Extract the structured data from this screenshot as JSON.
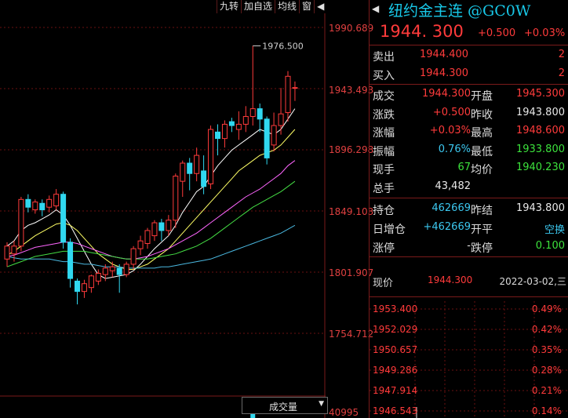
{
  "toolbar": {
    "items": [
      "九转",
      "加自选",
      "均线",
      "窗"
    ],
    "close_label": "◀"
  },
  "price_axis": [
    "1990.689",
    "1943.493",
    "1896.298",
    "1849.103",
    "1801.907",
    "1754.712",
    "40995"
  ],
  "chart_annotation": "1976.500",
  "volume_selector": {
    "label": "成交量",
    "arrow": "▼"
  },
  "title": {
    "text": "纽约金主连 @GC0W",
    "icon": "◀"
  },
  "quote": {
    "price": "1944. 300",
    "change": "+0.500",
    "change_pct": "+0.03%"
  },
  "orderbook": [
    {
      "label": "卖出",
      "price": "1944.400",
      "qty": "2"
    },
    {
      "label": "买入",
      "price": "1944.300",
      "qty": "2"
    }
  ],
  "stats": [
    {
      "l1": "成交",
      "v1": "1944.300",
      "l2": "开盘",
      "v2": "1945.300",
      "c1": "red",
      "c2": "red"
    },
    {
      "l1": "涨跌",
      "v1": "+0.500",
      "l2": "昨收",
      "v2": "1943.800",
      "c1": "red",
      "c2": "wht"
    },
    {
      "l1": "涨幅",
      "v1": "+0.03%",
      "l2": "最高",
      "v2": "1948.600",
      "c1": "red",
      "c2": "red"
    },
    {
      "l1": "振幅",
      "v1": "0.76%",
      "l2": "最低",
      "v2": "1933.800",
      "c1": "cyn",
      "c2": "grn"
    },
    {
      "l1": "现手",
      "v1": "67",
      "l2": "均价",
      "v2": "1940.230",
      "c1": "grn",
      "c2": "grn"
    },
    {
      "l1": "总手",
      "v1": "43,482",
      "l2": "",
      "v2": "",
      "c1": "wht",
      "c2": "wht"
    }
  ],
  "stats2": [
    {
      "l1": "持仓",
      "v1": "462669",
      "l2": "昨结",
      "v2": "1943.800",
      "c1": "cyn",
      "c2": "wht"
    },
    {
      "l1": "日增仓",
      "v1": "+462669",
      "l2": "开平",
      "v2": "空换",
      "c1": "cyn",
      "c2": "cyn"
    },
    {
      "l1": "涨停",
      "v1": "-",
      "l2": "跌停",
      "v2": "0.100",
      "c1": "wht",
      "c2": "grn"
    }
  ],
  "mini": {
    "label": "现价",
    "price": "1944.300",
    "date": "2022-03-02,三",
    "left_axis": [
      "1953.400",
      "1952.029",
      "1950.657",
      "1949.286",
      "1947.914",
      "1946.543"
    ],
    "right_axis": [
      "0.49%",
      "0.42%",
      "0.35%",
      "0.28%",
      "0.21%",
      "0.14%"
    ]
  },
  "chart_data": {
    "type": "candlestick",
    "ylim": [
      1754.712,
      1990.689
    ],
    "y_ticks": [
      1990.689,
      1943.493,
      1896.298,
      1849.103,
      1801.907,
      1754.712
    ],
    "candles": [
      [
        1812,
        1822,
        1806,
        1825,
        "up"
      ],
      [
        1816,
        1822,
        1810,
        1826,
        "up"
      ],
      [
        1822,
        1858,
        1818,
        1860,
        "up"
      ],
      [
        1858,
        1852,
        1848,
        1862,
        "dn"
      ],
      [
        1850,
        1856,
        1847,
        1858,
        "up"
      ],
      [
        1855,
        1850,
        1845,
        1858,
        "dn"
      ],
      [
        1852,
        1858,
        1848,
        1861,
        "up"
      ],
      [
        1853,
        1862,
        1850,
        1866,
        "up"
      ],
      [
        1862,
        1825,
        1820,
        1864,
        "dn"
      ],
      [
        1825,
        1797,
        1790,
        1828,
        "dn"
      ],
      [
        1795,
        1787,
        1777,
        1797,
        "dn"
      ],
      [
        1787,
        1793,
        1782,
        1796,
        "up"
      ],
      [
        1790,
        1799,
        1786,
        1800,
        "up"
      ],
      [
        1795,
        1801,
        1792,
        1804,
        "up"
      ],
      [
        1800,
        1805,
        1795,
        1808,
        "up"
      ],
      [
        1803,
        1806,
        1798,
        1810,
        "up"
      ],
      [
        1805,
        1800,
        1786,
        1808,
        "dn"
      ],
      [
        1800,
        1808,
        1798,
        1810,
        "up"
      ],
      [
        1808,
        1820,
        1804,
        1822,
        "up"
      ],
      [
        1820,
        1826,
        1815,
        1830,
        "up"
      ],
      [
        1824,
        1834,
        1820,
        1836,
        "up"
      ],
      [
        1830,
        1840,
        1826,
        1842,
        "up"
      ],
      [
        1840,
        1834,
        1826,
        1843,
        "dn"
      ],
      [
        1834,
        1842,
        1830,
        1846,
        "up"
      ],
      [
        1842,
        1876,
        1836,
        1878,
        "up"
      ],
      [
        1872,
        1886,
        1860,
        1888,
        "up"
      ],
      [
        1886,
        1878,
        1865,
        1890,
        "dn"
      ],
      [
        1878,
        1892,
        1872,
        1898,
        "up"
      ],
      [
        1880,
        1868,
        1862,
        1892,
        "dn"
      ],
      [
        1870,
        1912,
        1866,
        1915,
        "up"
      ],
      [
        1910,
        1905,
        1892,
        1916,
        "dn"
      ],
      [
        1905,
        1916,
        1898,
        1919,
        "up"
      ],
      [
        1915,
        1918,
        1910,
        1921,
        "dn"
      ],
      [
        1912,
        1916,
        1904,
        1926,
        "up"
      ],
      [
        1916,
        1922,
        1910,
        1930,
        "up"
      ],
      [
        1922,
        1928,
        1915,
        1976.5,
        "up"
      ],
      [
        1928,
        1920,
        1910,
        1932,
        "dn"
      ],
      [
        1920,
        1890,
        1885,
        1922,
        "dn"
      ],
      [
        1900,
        1915,
        1895,
        1925,
        "up"
      ],
      [
        1915,
        1924,
        1908,
        1944,
        "up"
      ],
      [
        1925,
        1953,
        1918,
        1957,
        "up"
      ],
      [
        1944,
        1944.3,
        1934,
        1949,
        "up"
      ]
    ],
    "ma_lines": [
      {
        "color": "#ffffff",
        "values": [
          1822,
          1826,
          1834,
          1838,
          1840,
          1843,
          1846,
          1850,
          1846,
          1838,
          1828,
          1818,
          1808,
          1800,
          1797,
          1798,
          1799,
          1800,
          1803,
          1808,
          1814,
          1820,
          1825,
          1830,
          1838,
          1848,
          1856,
          1864,
          1868,
          1876,
          1884,
          1890,
          1896,
          1900,
          1904,
          1908,
          1912,
          1910,
          1908,
          1912,
          1920,
          1928
        ]
      },
      {
        "color": "#ffff66",
        "values": [
          1815,
          1818,
          1822,
          1826,
          1830,
          1833,
          1836,
          1839,
          1840,
          1838,
          1834,
          1828,
          1822,
          1816,
          1812,
          1808,
          1806,
          1804,
          1804,
          1806,
          1808,
          1812,
          1816,
          1820,
          1826,
          1832,
          1838,
          1844,
          1850,
          1856,
          1862,
          1868,
          1874,
          1880,
          1884,
          1888,
          1892,
          1894,
          1896,
          1900,
          1906,
          1912
        ]
      },
      {
        "color": "#ff66ff",
        "values": [
          1814,
          1815,
          1817,
          1819,
          1821,
          1822,
          1823,
          1824,
          1825,
          1825,
          1824,
          1822,
          1820,
          1818,
          1816,
          1814,
          1813,
          1812,
          1812,
          1813,
          1814,
          1816,
          1818,
          1820,
          1823,
          1826,
          1829,
          1832,
          1836,
          1840,
          1844,
          1848,
          1852,
          1856,
          1860,
          1863,
          1866,
          1870,
          1874,
          1878,
          1884,
          1888
        ]
      },
      {
        "color": "#44dd44",
        "values": [
          1806,
          1808,
          1810,
          1812,
          1814,
          1815,
          1816,
          1817,
          1818,
          1818,
          1818,
          1818,
          1817,
          1816,
          1815,
          1814,
          1813,
          1812,
          1812,
          1812,
          1812,
          1813,
          1814,
          1815,
          1816,
          1818,
          1820,
          1822,
          1825,
          1828,
          1832,
          1836,
          1840,
          1844,
          1848,
          1852,
          1855,
          1858,
          1861,
          1864,
          1868,
          1872
        ]
      },
      {
        "color": "#4ab8e0",
        "values": [
          1814,
          1813,
          1812,
          1812,
          1812,
          1812,
          1812,
          1811,
          1810,
          1810,
          1809,
          1808,
          1808,
          1807,
          1806,
          1806,
          1806,
          1805,
          1805,
          1805,
          1805,
          1805,
          1806,
          1806,
          1807,
          1808,
          1809,
          1810,
          1811,
          1812,
          1814,
          1816,
          1818,
          1820,
          1822,
          1824,
          1826,
          1828,
          1830,
          1832,
          1835,
          1838
        ]
      }
    ]
  }
}
